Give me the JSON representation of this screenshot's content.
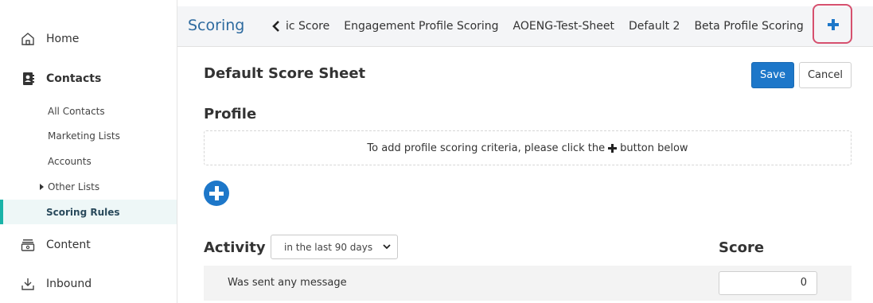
{
  "sidebar": {
    "main": [
      {
        "label": "Home",
        "icon": "home-icon"
      },
      {
        "label": "Contacts",
        "icon": "contacts-icon"
      },
      {
        "label": "Content",
        "icon": "content-icon"
      },
      {
        "label": "Inbound",
        "icon": "inbound-icon"
      }
    ],
    "sub": [
      {
        "label": "All Contacts"
      },
      {
        "label": "Marketing Lists"
      },
      {
        "label": "Accounts"
      },
      {
        "label": "Other Lists"
      },
      {
        "label": "Scoring Rules",
        "active": true
      }
    ]
  },
  "header": {
    "title": "Scoring",
    "tabs": [
      "ic Score",
      "Engagement Profile Scoring",
      "AOENG-Test-Sheet",
      "Default 2",
      "Beta Profile Scoring"
    ],
    "add_icon": "plus-icon",
    "highlight_color": "#d6506e"
  },
  "main": {
    "sheet_title": "Default Score Sheet",
    "save_label": "Save",
    "cancel_label": "Cancel",
    "profile_heading": "Profile",
    "profile_hint_before": "To add profile scoring criteria, please click the",
    "profile_hint_after": "button below",
    "activity_heading": "Activity",
    "activity_range": "in the last 90 days",
    "score_heading": "Score",
    "activity_rows": [
      {
        "label": "Was sent any message",
        "score": "0"
      }
    ]
  },
  "colors": {
    "accent": "#1d77c9",
    "active_bar": "#1ab3a8",
    "title_blue": "#2d6a9f"
  }
}
